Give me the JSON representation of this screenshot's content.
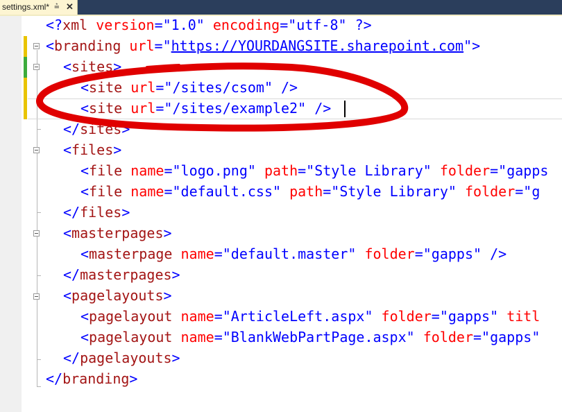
{
  "tab": {
    "label": "settings.xml*",
    "pin_icon": "pin-icon",
    "close_icon": "close-icon"
  },
  "lines": [
    [
      "<?",
      "xml",
      " ",
      "version",
      "=\"",
      "1.0",
      "\"",
      " ",
      "encoding",
      "=\"",
      "utf-8",
      "\"",
      " ",
      "?>"
    ],
    [
      "<",
      "branding",
      " ",
      "url",
      "=\"",
      "https://YOURDANGSITE.sharepoint.com",
      "\">"
    ],
    [
      "<",
      "sites",
      ">"
    ],
    [
      "<",
      "site",
      " ",
      "url",
      "=\"",
      "/sites/csom",
      "\" />"
    ],
    [
      "<",
      "site",
      " ",
      "url",
      "=\"",
      "/sites/example2",
      "\" />"
    ],
    [
      "</",
      "sites",
      ">"
    ],
    [
      "<",
      "files",
      ">"
    ],
    [
      "<",
      "file",
      " ",
      "name",
      "=\"",
      "logo.png",
      "\"",
      " ",
      "path",
      "=\"",
      "Style Library",
      "\"",
      " ",
      "folder",
      "=\"",
      "gapps"
    ],
    [
      "<",
      "file",
      " ",
      "name",
      "=\"",
      "default.css",
      "\"",
      " ",
      "path",
      "=\"",
      "Style Library",
      "\"",
      " ",
      "folder",
      "=\"",
      "g"
    ],
    [
      "</",
      "files",
      ">"
    ],
    [
      "<",
      "masterpages",
      ">"
    ],
    [
      "<",
      "masterpage",
      " ",
      "name",
      "=\"",
      "default.master",
      "\"",
      " ",
      "folder",
      "=\"",
      "gapps",
      "\" />"
    ],
    [
      "</",
      "masterpages",
      ">"
    ],
    [
      "<",
      "pagelayouts",
      ">"
    ],
    [
      "<",
      "pagelayout",
      " ",
      "name",
      "=\"",
      "ArticleLeft.aspx",
      "\"",
      " ",
      "folder",
      "=\"",
      "gapps",
      "\"",
      " ",
      "titl"
    ],
    [
      "<",
      "pagelayout",
      " ",
      "name",
      "=\"",
      "BlankWebPartPage.aspx",
      "\"",
      " ",
      "folder",
      "=\"",
      "gapps",
      "\""
    ],
    [
      "</",
      "pagelayouts",
      ">"
    ],
    [
      "</",
      "branding",
      ">"
    ]
  ],
  "colors": {
    "punct": "#0000ff",
    "tag": "#a31515",
    "attr": "#ff0000",
    "value": "#0000ff",
    "annotation": "#e00000",
    "change_saved": "#e9c400",
    "change_unsaved": "#3cab3c",
    "tab_active": "#fdf5d2"
  }
}
